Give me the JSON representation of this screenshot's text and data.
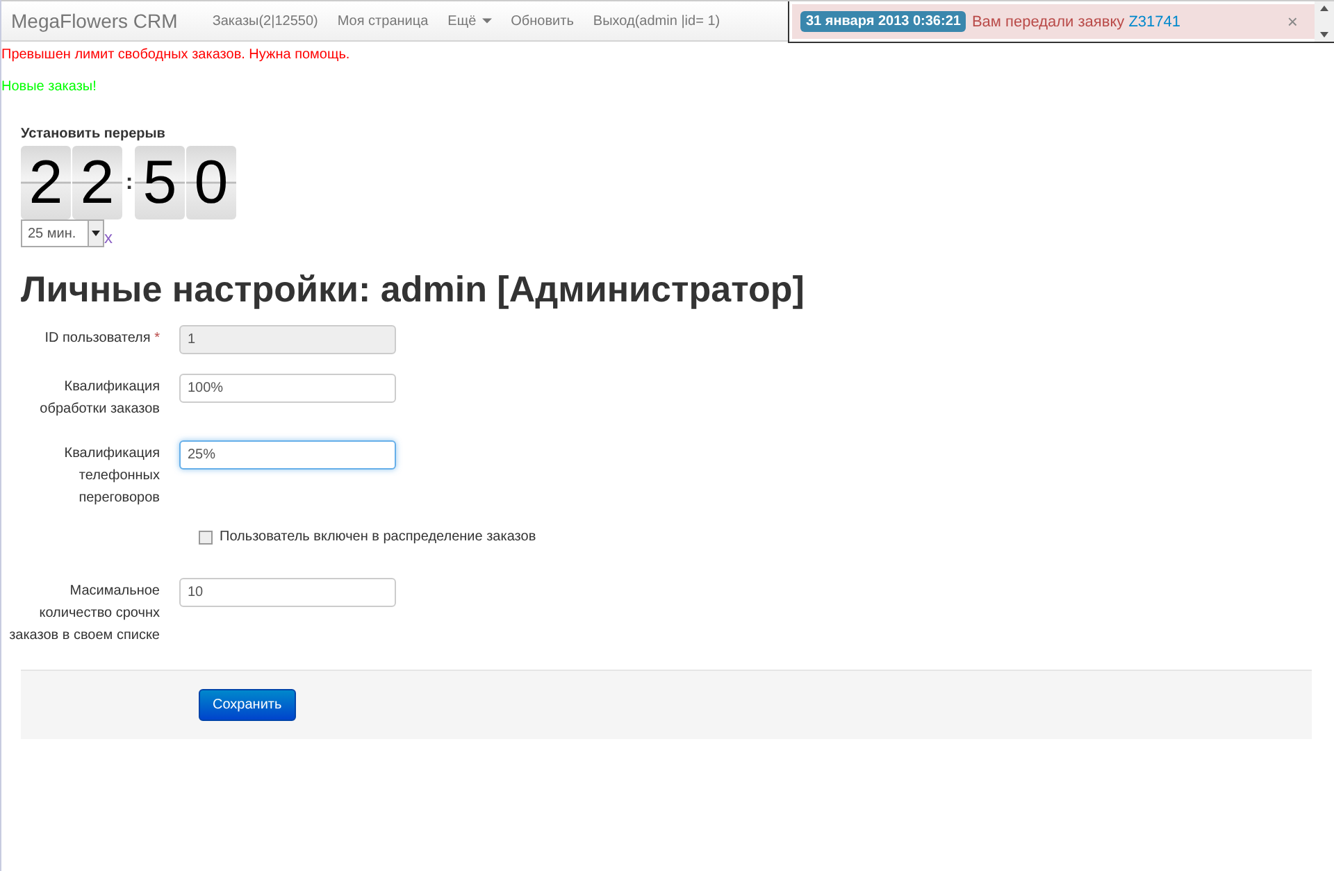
{
  "navbar": {
    "brand": "MegaFlowers CRM",
    "items": [
      {
        "label": "Заказы(2|12550)",
        "dropdown": false
      },
      {
        "label": "Моя страница",
        "dropdown": false
      },
      {
        "label": "Ещё",
        "dropdown": true
      },
      {
        "label": "Обновить",
        "dropdown": false
      },
      {
        "label": "Выход(admin |id= 1)",
        "dropdown": false
      }
    ]
  },
  "notification": {
    "timestamp": "31 января 2013 0:36:21",
    "message": "Вам передали заявку",
    "link": "Z31741",
    "close": "×"
  },
  "alerts": [
    {
      "text": "Превышен лимит свободных заказов. Нужна помощь.",
      "kind": "error"
    },
    {
      "text": "Новые заказы!",
      "kind": "success"
    }
  ],
  "break_timer": {
    "title": "Установить перерыв",
    "digits": [
      "2",
      "2",
      "5",
      "0"
    ],
    "separator": ":",
    "duration": "25 мин.",
    "clear": "x"
  },
  "heading": "Личные настройки: admin [Администратор]",
  "form": {
    "fields": [
      {
        "kind": "input",
        "label": "ID пользователя",
        "required_mark": "*",
        "value": "1",
        "disabled": true,
        "focused": false
      },
      {
        "kind": "input",
        "label": "Квалификация обработки заказов",
        "value": "100%",
        "disabled": false,
        "focused": false
      },
      {
        "kind": "input",
        "label": "Квалификация телефонных переговоров",
        "value": "25%",
        "disabled": false,
        "focused": true
      },
      {
        "kind": "checkbox",
        "label": "Пользователь включен в распределение заказов",
        "checked": false
      },
      {
        "kind": "input",
        "label": "Масимальное количество срочнх заказов в своем списке",
        "value": "10",
        "disabled": false,
        "focused": false
      }
    ],
    "submit": "Сохранить"
  }
}
